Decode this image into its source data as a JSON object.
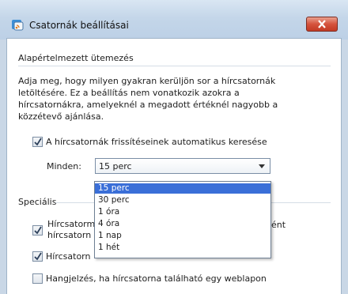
{
  "window": {
    "title": "Csatornák beállításai"
  },
  "group": {
    "title": "Alapértelmezett ütemezés"
  },
  "description": [
    "Adja meg, hogy milyen gyakran kerüljön sor a hírcsatornák",
    "letöltésére. Ez a beállítás nem vonatkozik azokra a",
    "hírcsatornákra, amelyeknél a megadott értéknél nagyobb a",
    "közzétevő ajánlása."
  ],
  "auto_check": {
    "label": "A hírcsatornák frissítéseinek automatikus keresése",
    "checked": true
  },
  "interval": {
    "label": "Minden:",
    "selected": "15 perc",
    "options": [
      "15 perc",
      "30 perc",
      "1 óra",
      "4 óra",
      "1 nap",
      "1 hét"
    ]
  },
  "special": {
    "title": "Speciális",
    "items": [
      {
        "label_1": "Hírcsatorm",
        "label_2": "hírcsatorn",
        "tail": "ént",
        "checked": true
      },
      {
        "label": "Hírcsatorn",
        "checked": true
      },
      {
        "label": "Hangjelzés, ha hírcsatorna található egy weblapon",
        "checked": false
      }
    ]
  },
  "colors": {
    "selection": "#3a6fd8",
    "close_button": "#d5533d"
  }
}
